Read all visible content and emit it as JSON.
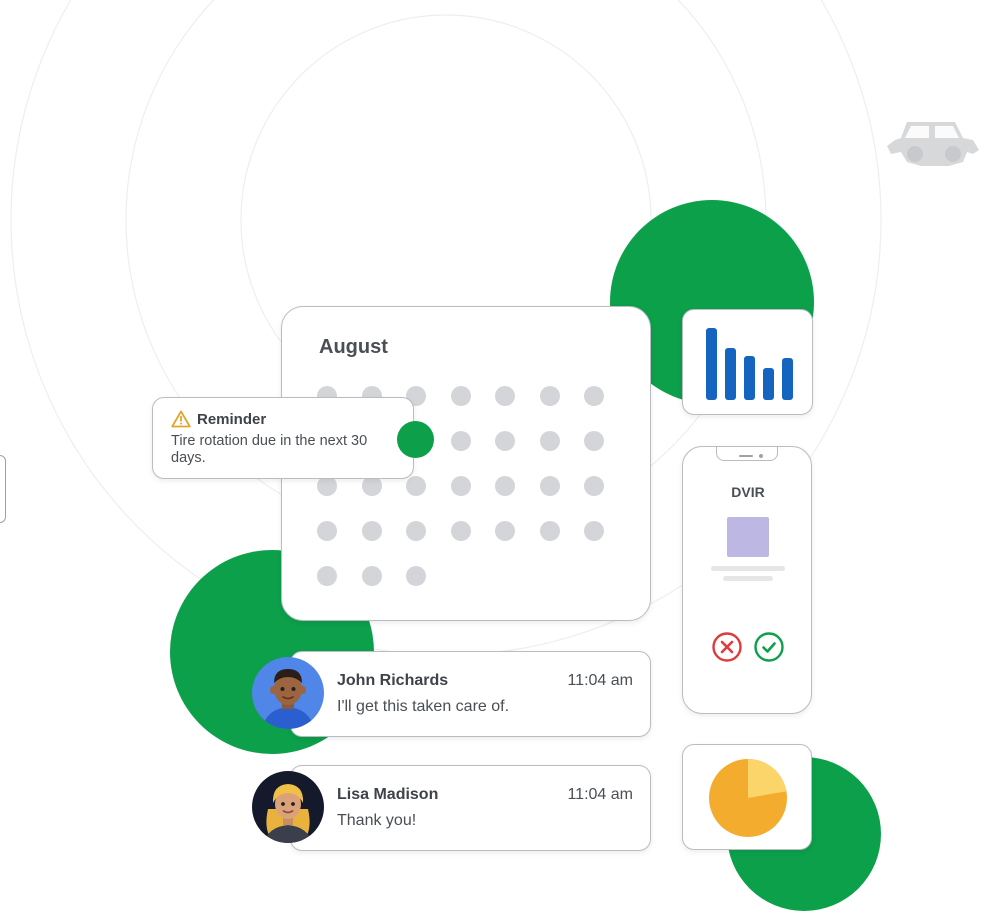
{
  "calendar": {
    "month": "August"
  },
  "reminder": {
    "title": "Reminder",
    "body": "Tire rotation due in the next 30 days.",
    "icon": "warning-icon",
    "icon_color": "#e3a52c"
  },
  "inspection": {
    "title": "DVIR",
    "reject_icon": "x-circle-icon",
    "approve_icon": "check-circle-icon",
    "reject_color": "#e03b3b",
    "approve_color": "#0ca04b"
  },
  "messages": [
    {
      "name": "John Richards",
      "time": "11:04 am",
      "text": "I'll get this taken care of."
    },
    {
      "name": "Lisa Madison",
      "time": "11:04 am",
      "text": "Thank you!"
    }
  ],
  "colors": {
    "accent_green": "#0ca04b",
    "bar_blue": "#1565c0",
    "pie_orange": "#f4ac2e",
    "pie_light": "#fbd46a"
  },
  "icons": {
    "vehicle": "offroad-vehicle-icon",
    "bar_chart": "bar-chart-icon",
    "pie_chart": "pie-chart-icon"
  }
}
